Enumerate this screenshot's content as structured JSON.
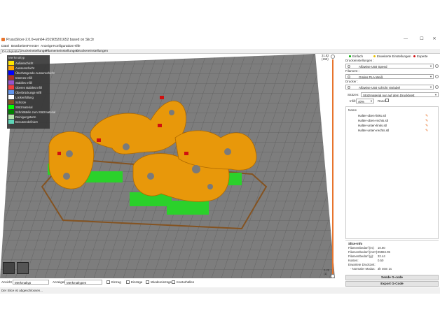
{
  "window": {
    "title": "PrusaSlicer-2.0.0+win64-201905201652 based on Slic3r",
    "minimize": "—",
    "maximize": "☐",
    "close": "✕"
  },
  "menu": [
    "Datei",
    "Bearbeiten",
    "Fenster",
    "Anzeige",
    "Konfiguration",
    "Hilfe"
  ],
  "tabs": [
    "Druckplatte",
    "Druckeinstellungen",
    "Filamenteinstellungen",
    "Druckereinstellungen"
  ],
  "legend": {
    "title": "Merkmaltyp",
    "items": [
      {
        "label": "Außenschicht",
        "color": "#ffe600"
      },
      {
        "label": "Aussenschicht",
        "color": "#ffa500"
      },
      {
        "label": "Überhängende Aussenschicht",
        "color": "#0000ff"
      },
      {
        "label": "Internes Infill",
        "color": "#b03029"
      },
      {
        "label": "Stabiles Infill",
        "color": "#9654cc"
      },
      {
        "label": "Oberes stabiles Infill",
        "color": "#f04040"
      },
      {
        "label": "Überbrückungs-Infill",
        "color": "#6495ed"
      },
      {
        "label": "Lückenfüllung",
        "color": "#ffffff"
      },
      {
        "label": "Schürze",
        "color": "#845321"
      },
      {
        "label": "Stützmaterial",
        "color": "#00ff00"
      },
      {
        "label": "Schnittstelle zum Stützmaterial",
        "color": "#008000"
      },
      {
        "label": "Reinigungsturm",
        "color": "#b3e3ab"
      },
      {
        "label": "Benutzerdefiniert",
        "color": "#5ed6b8"
      }
    ]
  },
  "layer_slider": {
    "top_value": "31.82",
    "top_layer": "(159)",
    "bottom_value": "0.20",
    "bottom_layer": "(1)"
  },
  "sidebar": {
    "modes": [
      {
        "label": "Einfach",
        "color": "#00b000"
      },
      {
        "label": "Erweiterte Einstellungen",
        "color": "#e8c000"
      },
      {
        "label": "Experte",
        "color": "#d01010"
      }
    ],
    "print_settings_label": "Druckeinstellungen :",
    "print_settings_value": "Alfawise U50 Speed",
    "filament_label": "Filament :",
    "filament_value": "Gödes PLA Weiß",
    "printer_label": "Drucker :",
    "printer_value": "Alfawise U50 schicht Variabel",
    "supports_label": "Stützen:",
    "supports_value": "Stützmaterial nur auf dem Druckbrett",
    "infill_label": "Infill:",
    "infill_value": "40%",
    "brim_label": "Rand:",
    "objects_header": "Name",
    "objects": [
      "Halter-oben-links.stl",
      "Halter-oben-rechts.stl",
      "Halter-unten-links.stl",
      "Halter-unten-rechts.stl"
    ],
    "slice_info": {
      "title": "Slice-Info",
      "rows": [
        {
          "k": "Filamentbedarf (m):",
          "v": "10.80"
        },
        {
          "k": "Filamentbedarf (mm³):",
          "v": "25984.05"
        },
        {
          "k": "Filamentbedarf (g):",
          "v": "32.44"
        },
        {
          "k": "Kosten:",
          "v": "0.50"
        },
        {
          "k": "Erwartete Druckzeit:",
          "v": ""
        },
        {
          "k": "- Normaler Modus:",
          "v": "3h 46m 1s"
        }
      ]
    },
    "send_button": "Sende G-code",
    "export_button": "Export G-Code"
  },
  "bottombar": {
    "view_label": "Ansicht",
    "view_value": "Merkmaltyp",
    "show_label": "Anzeigen",
    "show_value": "Merkmaltypen",
    "checks": [
      "Einzug",
      "Einzüge",
      "Wiedereinzüge",
      "Konturhüllen"
    ]
  },
  "status": "Der Slice ist abgeschlossen..."
}
